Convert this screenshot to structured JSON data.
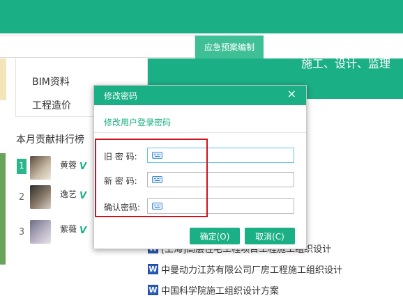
{
  "nav": {
    "emergency_plan_button": "应急预案编制"
  },
  "hero": {
    "text": "施工、设计、监理"
  },
  "menu": {
    "items": [
      {
        "label": "BIM资料"
      },
      {
        "label": "工程造价"
      }
    ]
  },
  "ranking": {
    "title": "本月贡献排行榜",
    "entries": [
      {
        "rank": "1",
        "name": "黄蓉",
        "badge": "V"
      },
      {
        "rank": "2",
        "name": "逸艺",
        "badge": "V"
      },
      {
        "rank": "3",
        "name": "紫薇",
        "badge": "V"
      }
    ]
  },
  "documents": {
    "items": [
      {
        "icon": "W",
        "title": "[上海]高层住宅工程项目工程施工组织设计"
      },
      {
        "icon": "W",
        "title": "中曼动力江苏有限公司厂房工程施工组织设计"
      },
      {
        "icon": "W",
        "title": "中国科学院施工组织设计方案"
      }
    ]
  },
  "dialog": {
    "title": "修改密码",
    "close_glyph": "×",
    "subtitle": "修改用户登录密码",
    "fields": [
      {
        "label": "旧 密 码:",
        "value": ""
      },
      {
        "label": "新 密 码:",
        "value": ""
      },
      {
        "label": "确认密码:",
        "value": ""
      }
    ],
    "confirm_label": "确定(O)",
    "cancel_label": "取消(C)"
  },
  "colors": {
    "brand": "#1aaf85",
    "highlight": "#d0131b",
    "word_icon": "#2b5db8"
  }
}
